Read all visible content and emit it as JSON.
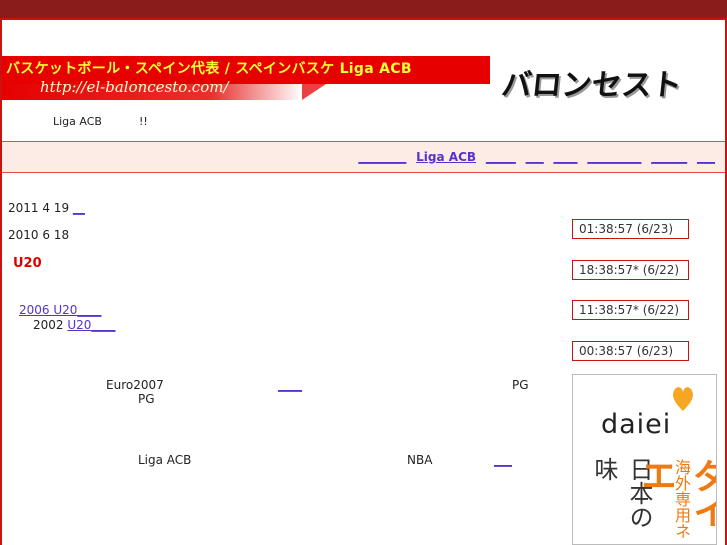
{
  "header": {
    "banner_title": "バスケットボール・スペイン代表 / スペインバスケ Liga ACB",
    "banner_url": "http://el-baloncesto.com/",
    "logo_text": "バロンセスト"
  },
  "tagline": {
    "text": "Liga ACB",
    "suffix": "!!"
  },
  "nav": {
    "links": [
      {
        "label": "________"
      },
      {
        "label": "Liga ACB"
      },
      {
        "label": "_____"
      },
      {
        "label": "___"
      },
      {
        "label": "____"
      },
      {
        "label": "_________"
      },
      {
        "label": "______"
      },
      {
        "label": "___"
      }
    ]
  },
  "main": {
    "date1": "2011 4 19",
    "date1_link": "__",
    "date2": "2010 6 18",
    "heading": "U20",
    "link_2006": "2006  U20",
    "link_2006_tail": "____",
    "year_2002": "2002",
    "link_2002": "U20",
    "link_2002_tail": "____",
    "euro": "Euro2007",
    "pg1": "PG",
    "euro_link": "____",
    "pg2": "PG",
    "liga": "Liga ACB",
    "nba": "NBA",
    "nba_link": "___"
  },
  "clocks": [
    {
      "time": "01:38:57 (6/23)"
    },
    {
      "time": "18:38:57* (6/22)"
    },
    {
      "time": "11:38:57* (6/22)"
    },
    {
      "time": "00:38:57 (6/23)"
    }
  ],
  "ad": {
    "logo": "daiei",
    "vertical_main": "ダイエ",
    "vertical_side": "海外専用ネ",
    "vertical_jp": "日本の味"
  },
  "colors": {
    "topbar": "#8b1c1c",
    "border_red": "#cc1111",
    "banner_red": "#e60000",
    "banner_title": "#ffff33",
    "link": "#5533cc",
    "heading_red": "#dd0000",
    "ad_orange": "#f07a12"
  }
}
